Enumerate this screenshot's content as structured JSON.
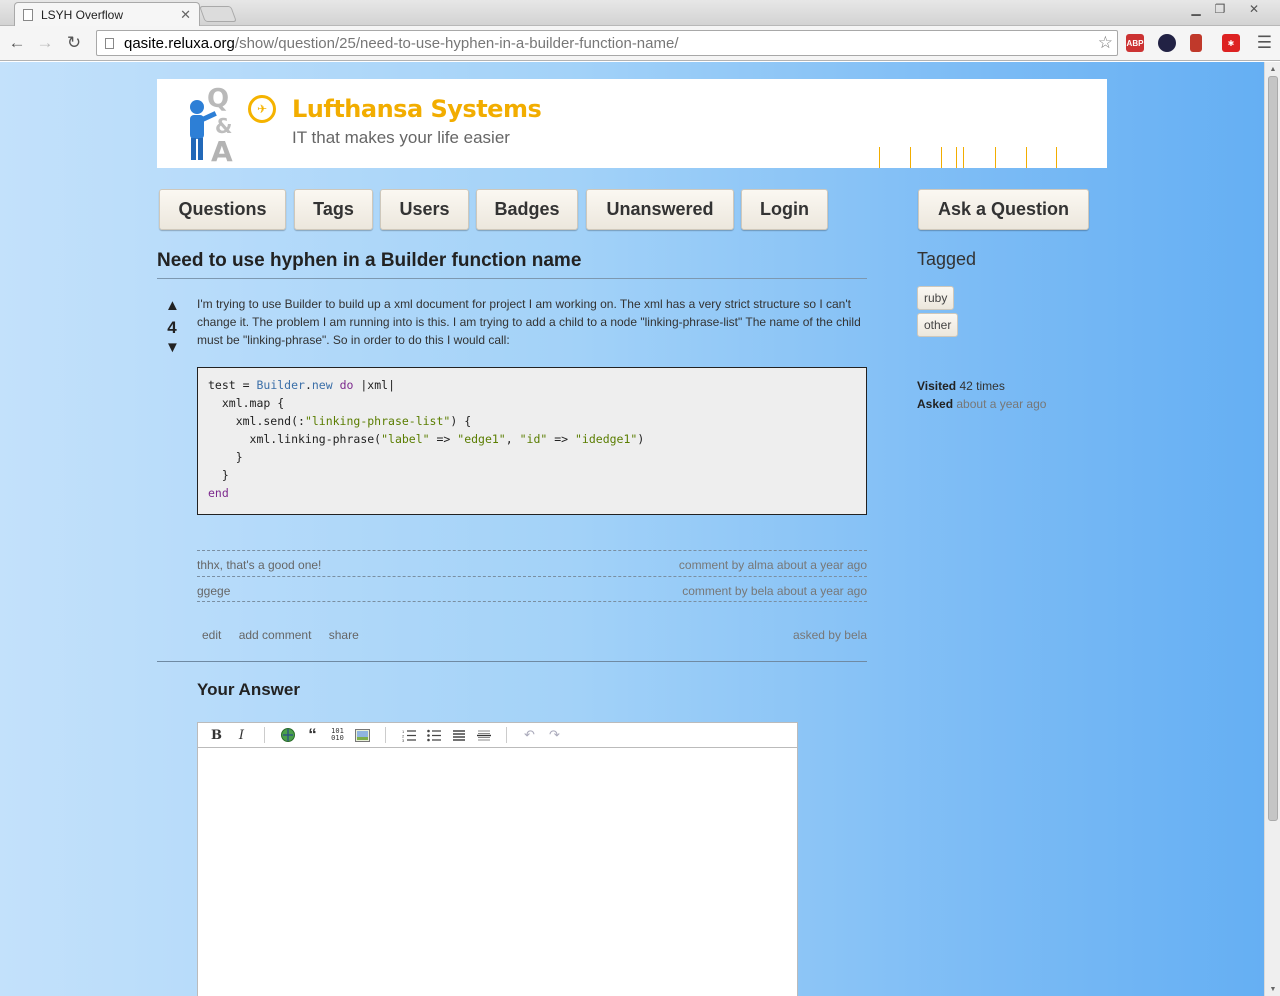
{
  "browser": {
    "tab_title": "LSYH Overflow",
    "tab_close": "✕",
    "url_host": "qasite.reluxa.org",
    "url_path": "/show/question/25/need-to-use-hyphen-in-a-builder-function-name/",
    "extensions": [
      "ABP",
      "",
      "",
      ""
    ]
  },
  "banner": {
    "brand_name": "Lufthansa Systems",
    "tagline": "IT that makes your life easier"
  },
  "nav": {
    "items": [
      "Questions",
      "Tags",
      "Users",
      "Badges",
      "Unanswered",
      "Login"
    ],
    "ask": "Ask a Question"
  },
  "question": {
    "title": "Need to use hyphen in a Builder function name",
    "votes": "4",
    "up_arrow": "▲",
    "down_arrow": "▼",
    "body": "I'm trying to use Builder to build up a xml document for project I am working on. The xml has a very strict structure so I can't change it. The problem I am running into is this. I am trying to add a child to a node \"linking-phrase-list\" The name of the child must be \"linking-phrase\". So in order to do this I would call:",
    "code_lines": [
      "test = Builder.new do |xml|",
      "  xml.map {",
      "    xml.send(:\"linking-phrase-list\") {",
      "      xml.linking-phrase(\"label\" => \"edge1\", \"id\" => \"idedge1\")",
      "    }",
      "  }",
      "end"
    ],
    "comments": [
      {
        "text": "thhx, that's a good one!",
        "meta": "comment by alma about a year ago"
      },
      {
        "text": "ggege",
        "meta": "comment by bela about a year ago"
      }
    ],
    "actions": [
      "edit",
      "add comment",
      "share"
    ],
    "asked_by": "asked by bela"
  },
  "answer": {
    "title": "Your Answer",
    "toolbar": [
      "B",
      "I",
      "link",
      "quote",
      "code",
      "image",
      "ol",
      "ul",
      "heading",
      "hr",
      "undo",
      "redo"
    ]
  },
  "sidebar": {
    "tagged_label": "Tagged",
    "tags": [
      "ruby",
      "other"
    ],
    "visited_label": "Visited",
    "visited_value": "42 times",
    "asked_label": "Asked",
    "asked_value": "about a year ago"
  },
  "colors": {
    "brand": "#f2ad00",
    "bg_light": "#c3e1fb",
    "bg_dark": "#65aff3"
  }
}
